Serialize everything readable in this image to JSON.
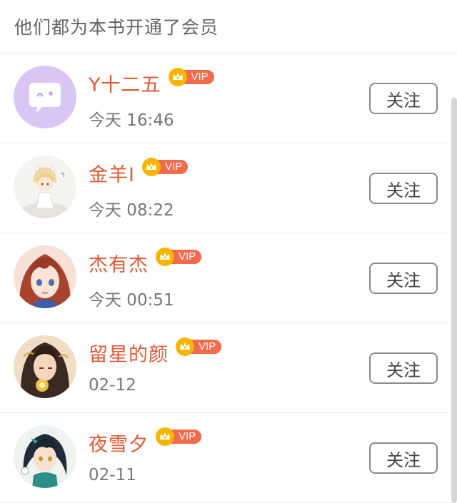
{
  "header": {
    "title": "他们都为本书开通了会员"
  },
  "vip_label": "VIP",
  "follow_label": "关注",
  "members": [
    {
      "name": "Y十二五",
      "time": "今天 16:46",
      "avatar": "chat-bubble-avatar"
    },
    {
      "name": "金羊I",
      "time": "今天 08:22",
      "avatar": "anime-blonde-avatar"
    },
    {
      "name": "杰有杰",
      "time": "今天 00:51",
      "avatar": "anime-redhair-avatar"
    },
    {
      "name": "留星的颜",
      "time": "02-12",
      "avatar": "anime-longhair-avatar"
    },
    {
      "name": "夜雪夕",
      "time": "02-11",
      "avatar": "anime-darkhair-avatar"
    }
  ],
  "colors": {
    "username": "#e05a34",
    "vip_pill": "#f26a4c",
    "crown": "#f7b500"
  }
}
